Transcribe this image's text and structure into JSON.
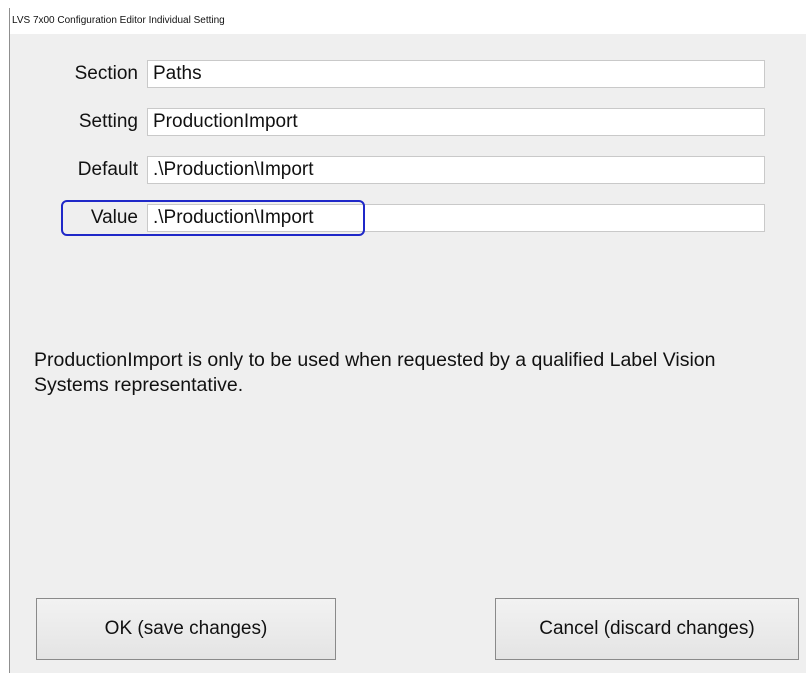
{
  "window": {
    "title": "LVS 7x00 Configuration Editor Individual Setting"
  },
  "form": {
    "section": {
      "label": "Section",
      "value": "Paths"
    },
    "setting": {
      "label": "Setting",
      "value": "ProductionImport"
    },
    "default": {
      "label": "Default",
      "value": ".\\Production\\Import"
    },
    "value": {
      "label": "Value",
      "value": ".\\Production\\Import"
    }
  },
  "message": {
    "text": "ProductionImport is only to be used when requested by a qualified Label Vision Systems representative."
  },
  "buttons": {
    "ok_label": "OK (save changes)",
    "cancel_label": "Cancel (discard changes)"
  },
  "colors": {
    "highlight_border": "#1f28c8",
    "dialog_background": "#efefef"
  }
}
